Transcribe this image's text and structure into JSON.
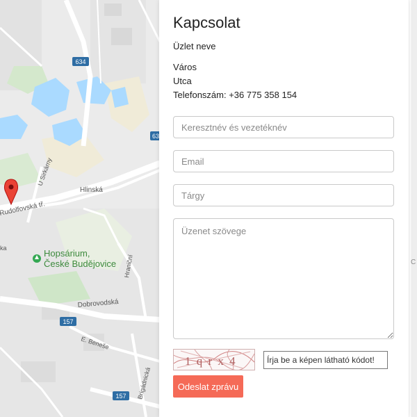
{
  "contact": {
    "title": "Kapcsolat",
    "shop_name": "Üzlet neve",
    "city": "Város",
    "street": "Utca",
    "phone": "Telefonszám: +36 775 358 154"
  },
  "form": {
    "name_placeholder": "Keresztnév és vezetéknév",
    "email_placeholder": "Email",
    "subject_placeholder": "Tárgy",
    "message_placeholder": "Üzenet szövege",
    "captcha_text": "1 q r x 4",
    "captcha_placeholder": "Írja be a képen látható kódot!",
    "submit_label": "Odeslat zprávu"
  },
  "map": {
    "road_labels": {
      "r634": "634",
      "r63": "63",
      "r157a": "157",
      "r157b": "157",
      "sirkalny": "U Sirkárny",
      "hlinska": "Hlinská",
      "rudolfovska": "Rudolfovská tř.",
      "hranicni": "Hraniční",
      "dobrovodska": "Dobrovodská",
      "benese": "E. Beneše",
      "brigadnicka": "Brigádnická"
    },
    "place": "Hopsárium,\nČeské Budějovice",
    "place_line1": "Hopsárium,",
    "place_line2": "České Budějovice",
    "edge_letter_1": "ka",
    "edge_letter_2": "C"
  },
  "colors": {
    "accent": "#f56a57",
    "water": "#aadaff",
    "park": "#c8e6c0",
    "road": "#ffffff",
    "pin": "#ea4335"
  }
}
